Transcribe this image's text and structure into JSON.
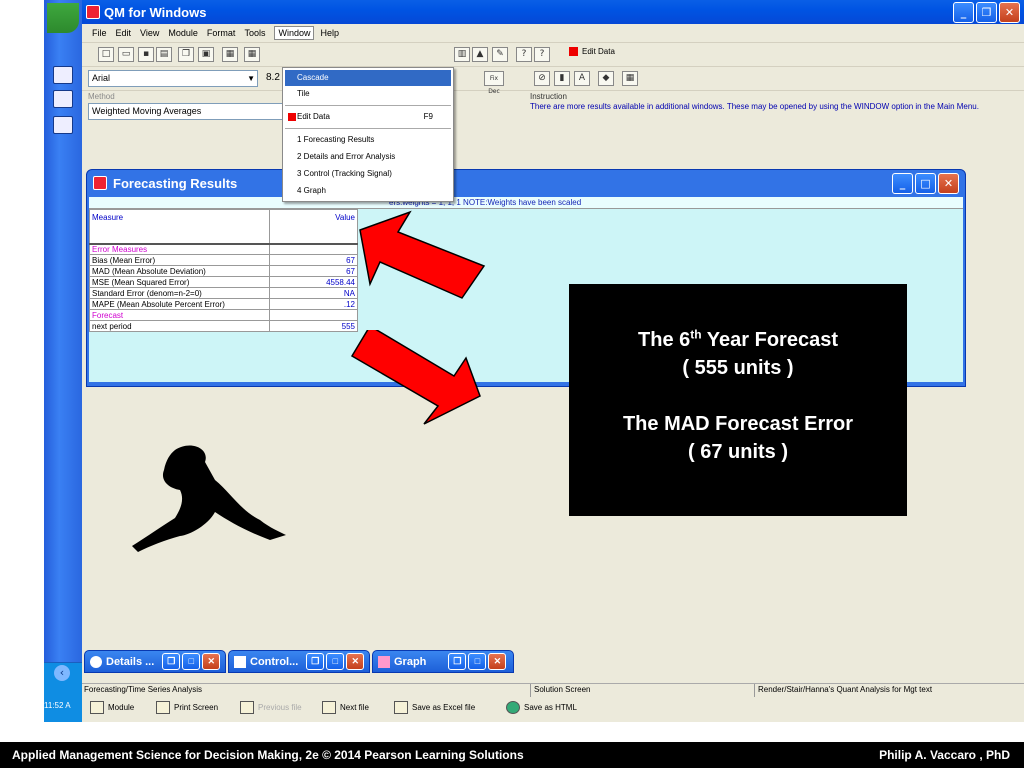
{
  "app": {
    "title": "QM for Windows",
    "clock": "11:52 A"
  },
  "menu": {
    "items": [
      "File",
      "Edit",
      "View",
      "Module",
      "Format",
      "Tools",
      "Window",
      "Help"
    ]
  },
  "toolbar": {
    "edit_data_label": "Edit Data",
    "font_name": "Arial",
    "font_size": "8.2",
    "fix_dec": "Fix Dec"
  },
  "method": {
    "label": "Method",
    "value": "Weighted Moving Averages"
  },
  "instruction": {
    "label": "Instruction",
    "text": "There are more results available in additional windows. These may be opened by using the WINDOW option in the Main Menu."
  },
  "window_menu": {
    "items": [
      {
        "label": "Cascade"
      },
      {
        "label": "Tile"
      },
      {
        "label": "Edit Data",
        "shortcut": "F9"
      },
      {
        "label": "1 Forecasting Results"
      },
      {
        "label": "2 Details and Error Analysis"
      },
      {
        "label": "3 Control (Tracking Signal)"
      },
      {
        "label": "4 Graph"
      }
    ]
  },
  "results": {
    "title": "Forecasting Results",
    "note": "ers:weights = 1, 1, 1 NOTE:Weights have been scaled",
    "header": {
      "measure": "Measure",
      "value": "Value"
    },
    "rows": [
      {
        "measure": "Error Measures",
        "value": ""
      },
      {
        "measure": "Bias (Mean Error)",
        "value": "67"
      },
      {
        "measure": "MAD (Mean Absolute Deviation)",
        "value": "67"
      },
      {
        "measure": "MSE (Mean Squared Error)",
        "value": "4558.44"
      },
      {
        "measure": "Standard Error (denom=n-2=0)",
        "value": "NA"
      },
      {
        "measure": "MAPE (Mean Absolute Percent Error)",
        "value": ".12"
      },
      {
        "measure": "Forecast",
        "value": ""
      },
      {
        "measure": "next period",
        "value": "555"
      }
    ]
  },
  "minimized": [
    {
      "label": "Details ..."
    },
    {
      "label": "Control..."
    },
    {
      "label": "Graph"
    }
  ],
  "status": {
    "left": "Forecasting/Time Series Analysis",
    "middle": "Solution Screen",
    "right": "Render/Stair/Hanna's Quant Analysis for Mgt text"
  },
  "bottom_toolbar": {
    "module": "Module",
    "print": "Print Screen",
    "previous": "Previous file",
    "next": "Next file",
    "excel": "Save as Excel file",
    "html": "Save as HTML"
  },
  "callout": {
    "line1_pre": "The 6",
    "line1_sup": "th",
    "line1_post": " Year Forecast",
    "line2": "( 555 units )",
    "line3": "The MAD Forecast Error",
    "line4": "( 67 units )"
  },
  "footer": {
    "left": "Applied Management Science for Decision Making, 2e © 2014 Pearson Learning Solutions",
    "right": "Philip A. Vaccaro , PhD"
  },
  "colors": {
    "titlebar": "#0054e3",
    "arrow": "#ff0000",
    "grid_bg": "#cdf5f7"
  }
}
